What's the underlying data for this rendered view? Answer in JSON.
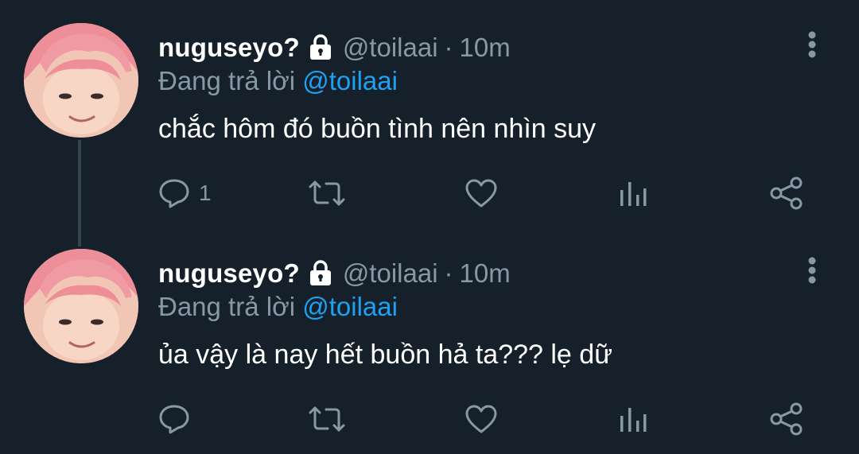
{
  "tweets": [
    {
      "display_name": "nuguseyo?",
      "handle": "@toilaai",
      "separator": "·",
      "time": "10m",
      "reply_prefix": "Đang trả lời",
      "reply_to": "@toilaai",
      "text": "chắc hôm đó buồn tình nên nhìn suy",
      "reply_count": "1"
    },
    {
      "display_name": "nuguseyo?",
      "handle": "@toilaai",
      "separator": "·",
      "time": "10m",
      "reply_prefix": "Đang trả lời",
      "reply_to": "@toilaai",
      "text": "ủa vậy là nay hết buồn hả ta??? lẹ dữ",
      "reply_count": ""
    }
  ],
  "icons": {
    "lock": "lock-icon",
    "more": "more-vertical-icon",
    "reply": "reply-icon",
    "retweet": "retweet-icon",
    "like": "heart-icon",
    "stats": "analytics-icon",
    "share": "share-icon"
  },
  "colors": {
    "background": "#15202b",
    "text_primary": "#ffffff",
    "text_secondary": "#8899a6",
    "accent": "#1da1f2",
    "thread_line": "#38444d"
  }
}
